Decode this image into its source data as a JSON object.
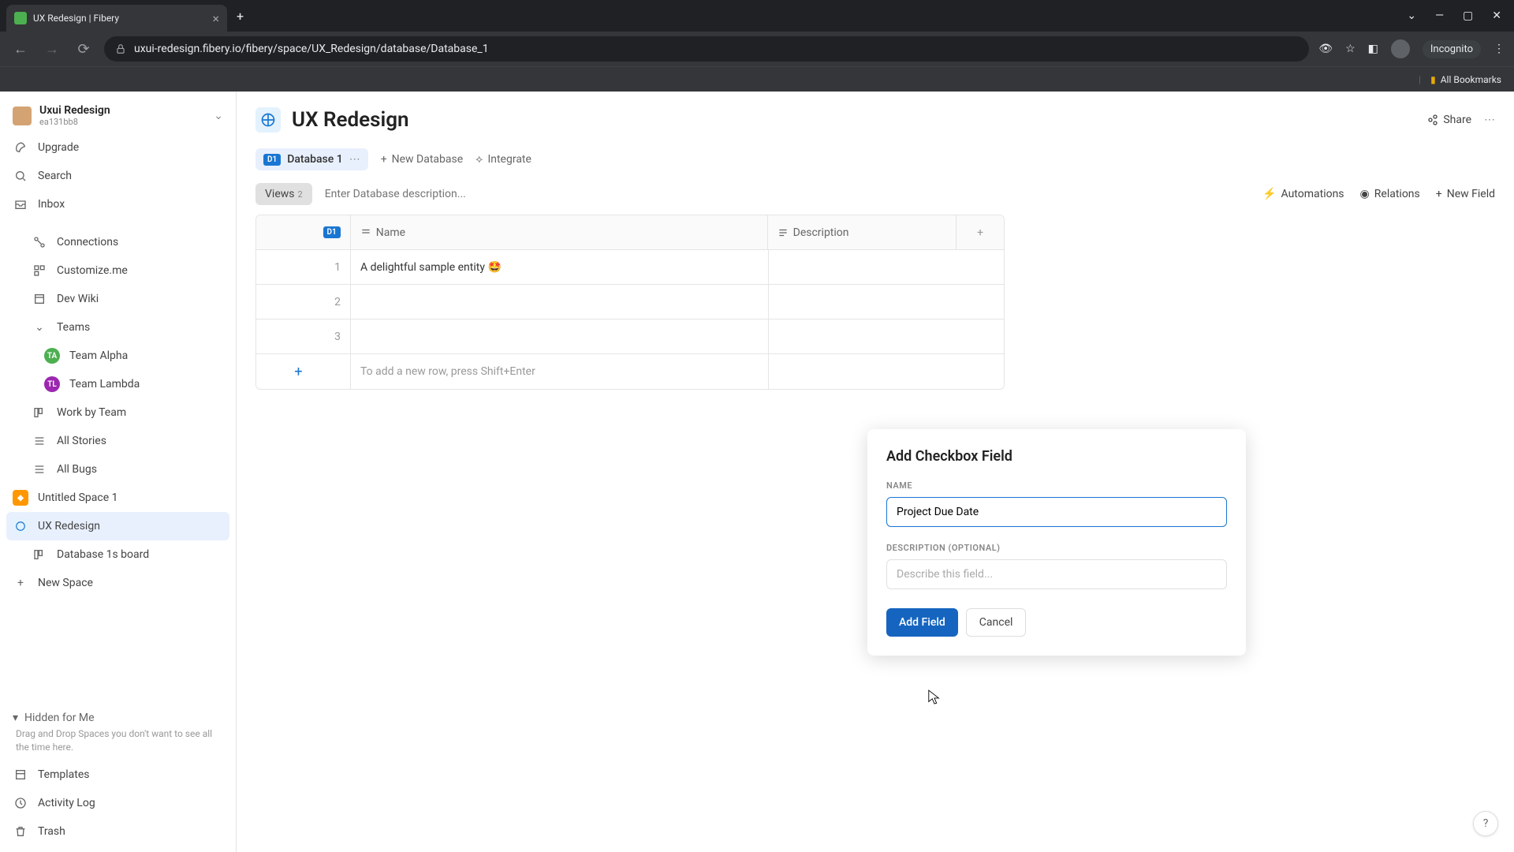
{
  "browser": {
    "tab_title": "UX Redesign | Fibery",
    "url": "uxui-redesign.fibery.io/fibery/space/UX_Redesign/database/Database_1",
    "incognito_label": "Incognito",
    "bookmarks_label": "All Bookmarks"
  },
  "workspace": {
    "name": "Uxui Redesign",
    "id": "ea131bb8"
  },
  "sidebar": {
    "upgrade": "Upgrade",
    "search": "Search",
    "inbox": "Inbox",
    "connections": "Connections",
    "customize": "Customize.me",
    "devwiki": "Dev Wiki",
    "teams": "Teams",
    "team_alpha": "Team Alpha",
    "team_lambda": "Team Lambda",
    "work_by_team": "Work by Team",
    "all_stories": "All Stories",
    "all_bugs": "All Bugs",
    "untitled_space": "Untitled Space 1",
    "ux_redesign": "UX Redesign",
    "db_board": "Database 1s board",
    "new_space": "New Space",
    "hidden_label": "Hidden for Me",
    "hidden_hint": "Drag and Drop Spaces you don't want to see all the time here.",
    "templates": "Templates",
    "activity_log": "Activity Log",
    "trash": "Trash"
  },
  "page": {
    "title": "UX Redesign",
    "share_label": "Share",
    "db_tab_badge": "D1",
    "db_tab_name": "Database 1",
    "new_database": "New Database",
    "integrate": "Integrate",
    "views_label": "Views",
    "views_count": "2",
    "desc_placeholder": "Enter Database description...",
    "automations": "Automations",
    "relations": "Relations",
    "new_field": "New Field"
  },
  "table": {
    "col_name": "Name",
    "col_desc": "Description",
    "header_badge": "D1",
    "rows": [
      "1",
      "2",
      "3"
    ],
    "sample_entity": "A delightful sample entity 🤩",
    "add_row_hint": "To add a new row, press Shift+Enter"
  },
  "popover": {
    "title": "Add Checkbox Field",
    "name_label": "Name",
    "name_value": "Project Due Date",
    "desc_label": "Description (optional)",
    "desc_placeholder": "Describe this field...",
    "add_btn": "Add Field",
    "cancel_btn": "Cancel"
  },
  "help_label": "?"
}
